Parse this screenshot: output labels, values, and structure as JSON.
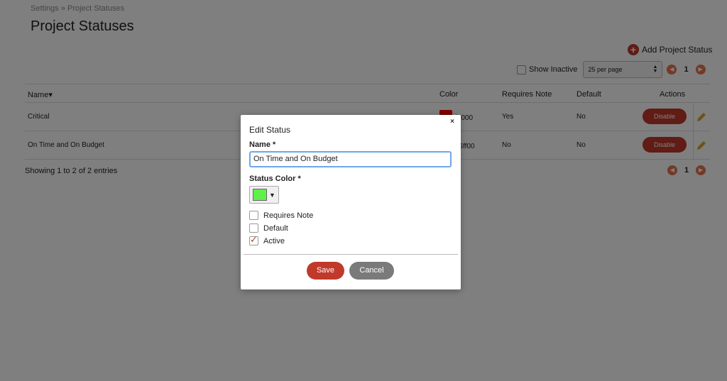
{
  "breadcrumb": {
    "parent": "Settings",
    "separator": "»",
    "current": "Project Statuses"
  },
  "page_title": "Project Statuses",
  "toolbar": {
    "add_label": "Add Project Status",
    "show_inactive_label": "Show Inactive",
    "per_page_value": "25 per page",
    "page_number": "1"
  },
  "table": {
    "headers": {
      "name": "Name",
      "color": "Color",
      "requires_note": "Requires Note",
      "default": "Default",
      "actions": "Actions"
    },
    "rows": [
      {
        "name": "Critical",
        "color_hex": "#ff0000",
        "color_text": "f0000",
        "requires_note": "Yes",
        "default": "No",
        "action_label": "Disable"
      },
      {
        "name": "On Time and On Budget",
        "color_hex": "#26ff00",
        "color_text": "26ff00",
        "requires_note": "No",
        "default": "No",
        "action_label": "Disable"
      }
    ],
    "summary": "Showing 1 to 2 of 2 entries",
    "page_number": "1"
  },
  "modal": {
    "close": "×",
    "title": "Edit Status",
    "name_label": "Name *",
    "name_value": "On Time and On Budget",
    "color_label": "Status Color *",
    "color_value": "#5ff04a",
    "checkboxes": [
      {
        "label": "Requires Note",
        "checked": false
      },
      {
        "label": "Default",
        "checked": false
      },
      {
        "label": "Active",
        "checked": true
      }
    ],
    "save_label": "Save",
    "cancel_label": "Cancel"
  },
  "colors": {
    "accent": "#c0392b",
    "pager_arrow": "#e8734f",
    "input_focus": "#6ea8e6"
  }
}
